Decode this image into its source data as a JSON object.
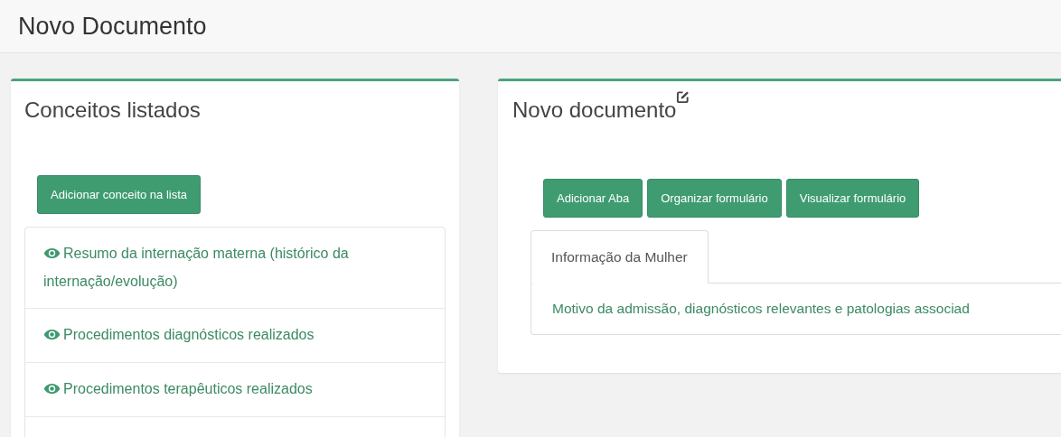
{
  "page": {
    "title": "Novo Documento"
  },
  "concepts_panel": {
    "title": "Conceitos listados",
    "add_button": "Adicionar conceito na lista",
    "items": [
      {
        "kind": "link",
        "text": "Resumo da internação materna (histórico da internação/evolução)"
      },
      {
        "kind": "link",
        "text": "Procedimentos diagnósticos realizados"
      },
      {
        "kind": "link",
        "text": "Procedimentos terapêuticos realizados"
      },
      {
        "kind": "empty"
      }
    ]
  },
  "document_panel": {
    "title": "Novo documento",
    "buttons": [
      "Adicionar Aba",
      "Organizar formulário",
      "Visualizar formulário"
    ],
    "tabs": [
      {
        "label": "Informação da Mulher",
        "selected": true
      }
    ],
    "fields": [
      {
        "text": "Motivo da admissão, diagnósticos relevantes e patologias associad"
      }
    ]
  }
}
